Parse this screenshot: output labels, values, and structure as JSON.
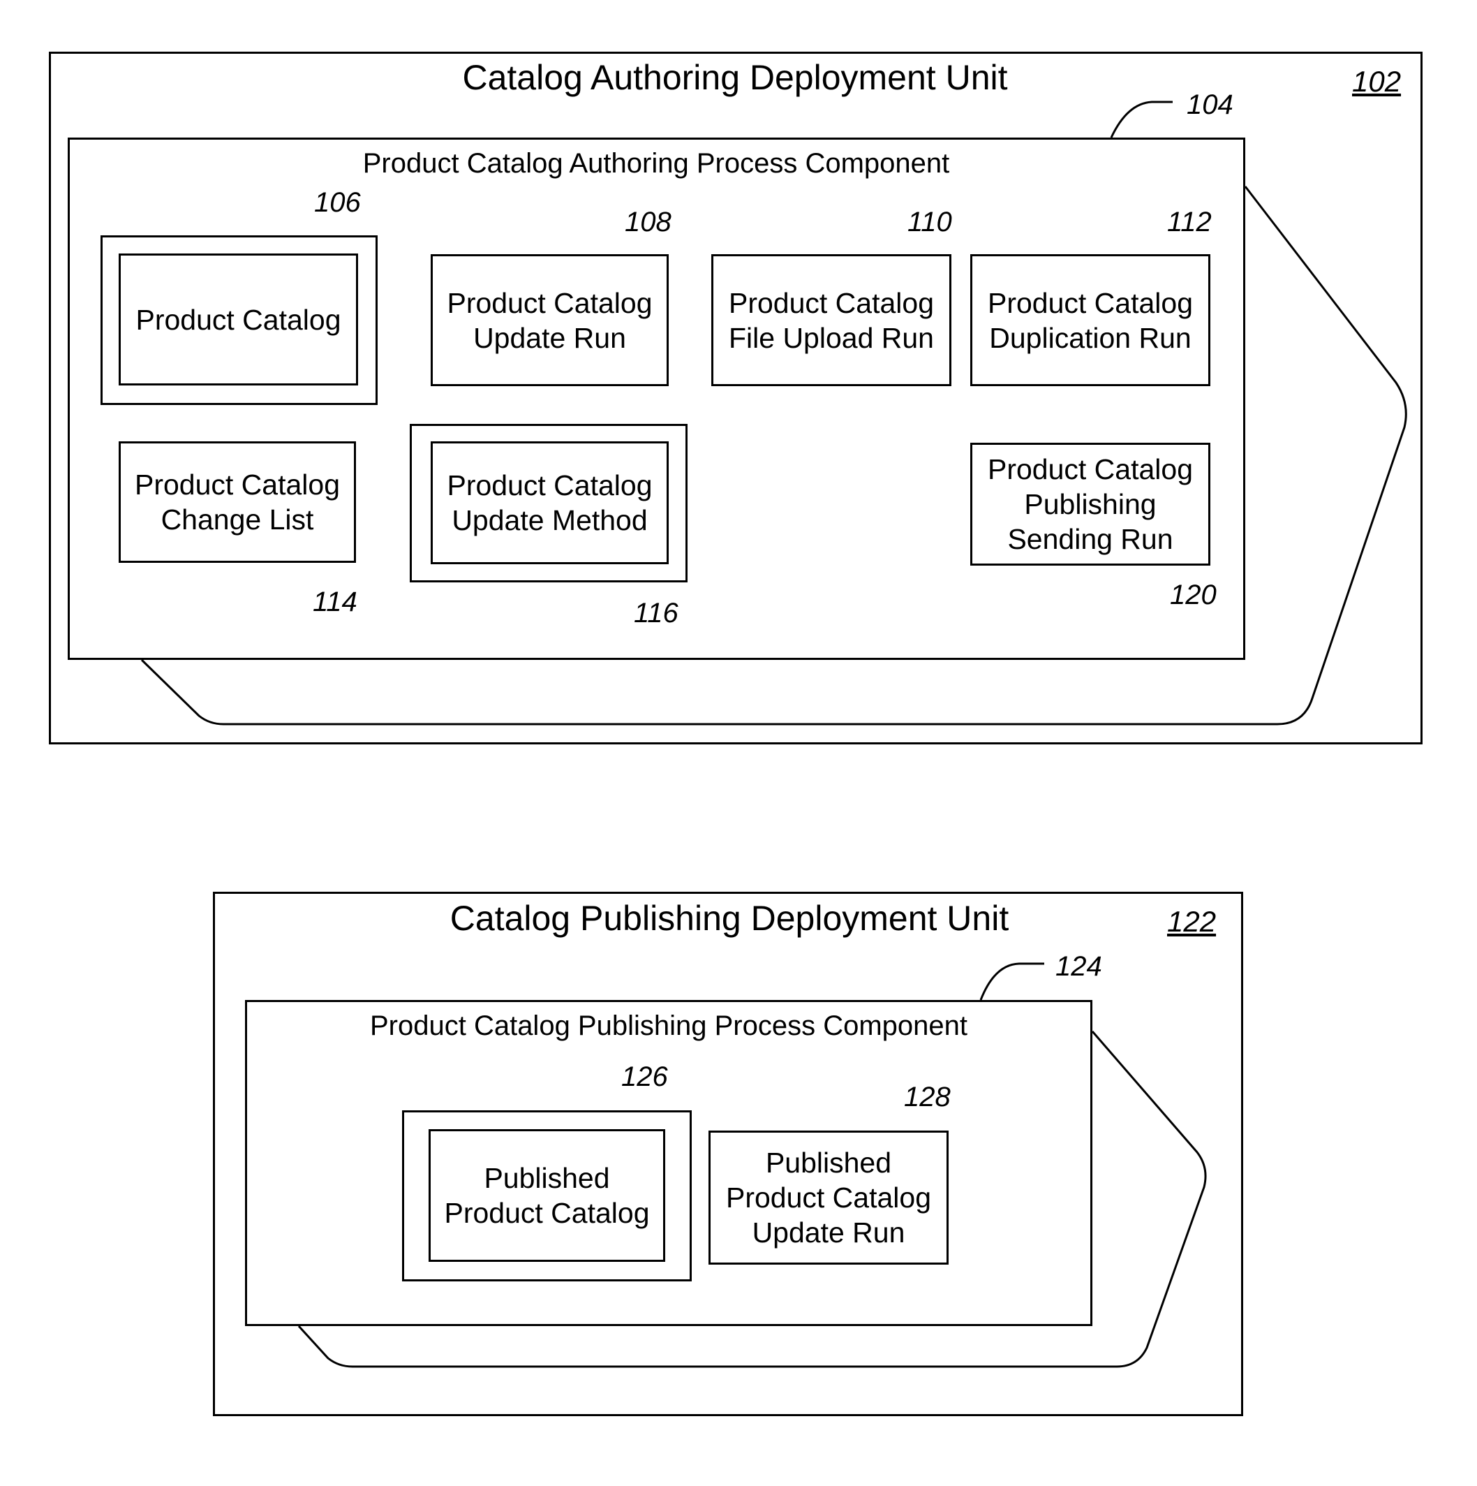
{
  "authoring_unit": {
    "title": "Catalog Authoring Deployment Unit",
    "ref": "102",
    "process_component": {
      "title": "Product Catalog Authoring Process Component",
      "ref": "104",
      "items": [
        {
          "label": "Product Catalog",
          "ref": "106",
          "kind": "business-object"
        },
        {
          "label": "Product Catalog\nUpdate Run",
          "ref": "108",
          "kind": "run"
        },
        {
          "label": "Product Catalog\nFile Upload Run",
          "ref": "110",
          "kind": "run"
        },
        {
          "label": "Product Catalog\nDuplication Run",
          "ref": "112",
          "kind": "run"
        },
        {
          "label": "Product Catalog\nChange List",
          "ref": "114",
          "kind": "dependent-object"
        },
        {
          "label": "Product Catalog\nUpdate Method",
          "ref": "116",
          "kind": "business-object"
        },
        {
          "label": "Product Catalog\nPublishing\nSending Run",
          "ref": "120",
          "kind": "run"
        }
      ]
    }
  },
  "publishing_unit": {
    "title": "Catalog Publishing Deployment Unit",
    "ref": "122",
    "process_component": {
      "title": "Product Catalog Publishing Process Component",
      "ref": "124",
      "items": [
        {
          "label": "Published\nProduct Catalog",
          "ref": "126",
          "kind": "business-object"
        },
        {
          "label": "Published\nProduct Catalog\nUpdate Run",
          "ref": "128",
          "kind": "run"
        }
      ]
    }
  }
}
